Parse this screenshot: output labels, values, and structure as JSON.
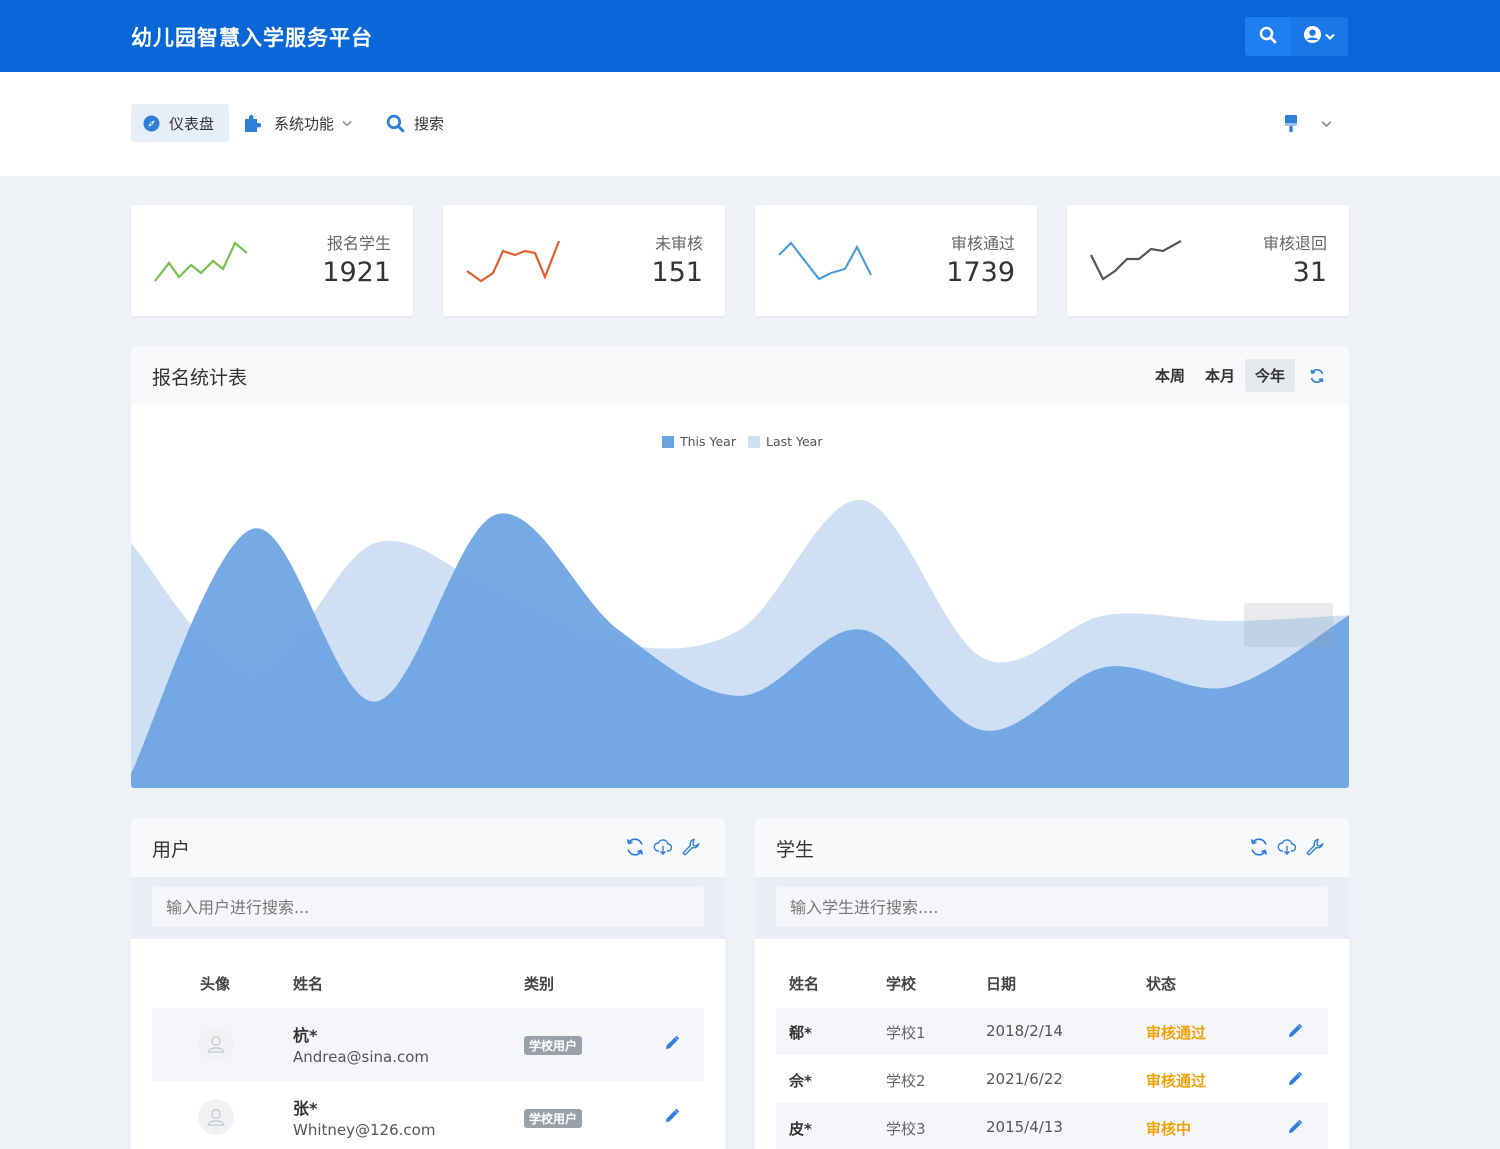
{
  "header": {
    "brand": "幼儿园智慧入学服务平台"
  },
  "nav": {
    "items": [
      {
        "label": "仪表盘",
        "icon": "compass-icon",
        "active": true
      },
      {
        "label": "系统功能",
        "icon": "puzzle-icon",
        "has_dropdown": true
      },
      {
        "label": "搜索",
        "icon": "search-icon"
      }
    ]
  },
  "stats": [
    {
      "label": "报名学生",
      "value": "1921",
      "color": "#7cc14f"
    },
    {
      "label": "未审核",
      "value": "151",
      "color": "#e06030"
    },
    {
      "label": "审核通过",
      "value": "1739",
      "color": "#4a9fdb"
    },
    {
      "label": "审核退回",
      "value": "31",
      "color": "#555555"
    }
  ],
  "chart_panel": {
    "title": "报名统计表",
    "ranges": [
      "本周",
      "本月",
      "今年"
    ],
    "active_range": "今年"
  },
  "chart_data": {
    "type": "area",
    "series": [
      {
        "name": "This Year",
        "color": "#6ba3e3",
        "values": [
          5,
          90,
          30,
          95,
          55,
          32,
          55,
          20,
          42,
          35,
          60
        ]
      },
      {
        "name": "Last Year",
        "color": "#cfe0f5",
        "values": [
          85,
          40,
          85,
          68,
          50,
          55,
          100,
          45,
          60,
          58,
          60
        ]
      }
    ],
    "xlabel": "",
    "ylabel": "",
    "grid": false,
    "legend": "top-center"
  },
  "users": {
    "title": "用户",
    "search_placeholder": "输入用户进行搜索...",
    "columns": [
      "头像",
      "姓名",
      "类别"
    ],
    "rows": [
      {
        "name": "杭*",
        "email": "Andrea@sina.com",
        "type": "学校用户"
      },
      {
        "name": "张*",
        "email": "Whitney@126.com",
        "type": "学校用户"
      }
    ]
  },
  "students": {
    "title": "学生",
    "search_placeholder": "输入学生进行搜索....",
    "columns": [
      "姓名",
      "学校",
      "日期",
      "状态"
    ],
    "rows": [
      {
        "name": "郗*",
        "school": "学校1",
        "date": "2018/2/14",
        "status": "审核通过"
      },
      {
        "name": "佘*",
        "school": "学校2",
        "date": "2021/6/22",
        "status": "审核通过"
      },
      {
        "name": "皮*",
        "school": "学校3",
        "date": "2015/4/13",
        "status": "审核中"
      }
    ]
  }
}
